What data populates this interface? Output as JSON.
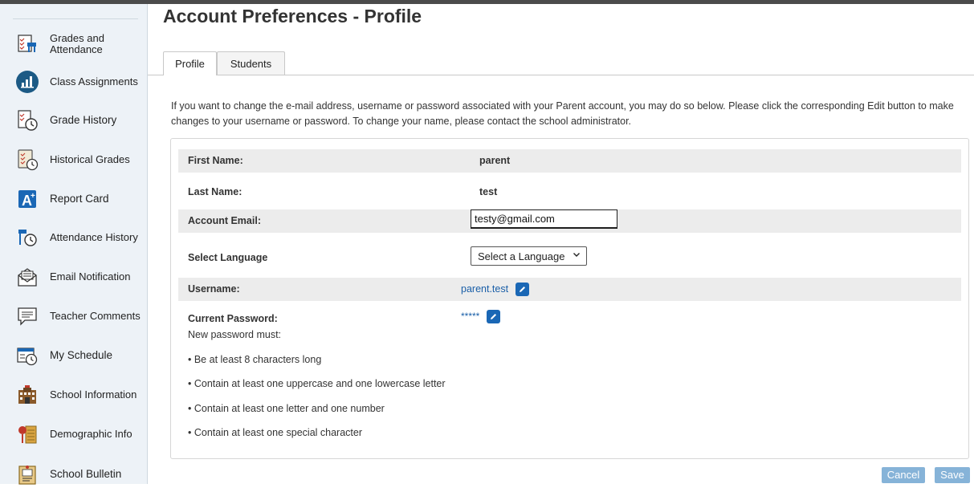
{
  "sidebar": {
    "items": [
      {
        "label": "Grades and Attendance",
        "icon": "grades-attendance-icon"
      },
      {
        "label": "Class Assignments",
        "icon": "class-assignments-icon"
      },
      {
        "label": "Grade History",
        "icon": "grade-history-icon"
      },
      {
        "label": "Historical Grades",
        "icon": "historical-grades-icon"
      },
      {
        "label": "Report Card",
        "icon": "report-card-icon"
      },
      {
        "label": "Attendance History",
        "icon": "attendance-history-icon"
      },
      {
        "label": "Email Notification",
        "icon": "email-notification-icon"
      },
      {
        "label": "Teacher Comments",
        "icon": "teacher-comments-icon"
      },
      {
        "label": "My Schedule",
        "icon": "my-schedule-icon"
      },
      {
        "label": "School Information",
        "icon": "school-information-icon"
      },
      {
        "label": "Demographic Info",
        "icon": "demographic-info-icon"
      },
      {
        "label": "School Bulletin",
        "icon": "school-bulletin-icon"
      }
    ]
  },
  "page": {
    "title": "Account Preferences - Profile",
    "tabs": [
      {
        "label": "Profile",
        "active": true
      },
      {
        "label": "Students",
        "active": false
      }
    ],
    "intro": "If you want to change the e-mail address, username or password associated with your Parent account, you may do so below. Please click the corresponding Edit button to make changes to your username or password. To change your name, please contact the school administrator."
  },
  "profile": {
    "first_name_label": "First Name:",
    "first_name": "parent",
    "last_name_label": "Last Name:",
    "last_name": "test",
    "email_label": "Account Email:",
    "email_value": "testy@gmail.com",
    "language_label": "Select Language",
    "language_selected": "Select a Language",
    "username_label": "Username:",
    "username": "parent.test",
    "password_label": "Current Password:",
    "password_masked": "*****",
    "pw_rules_heading": "New password must:",
    "pw_rules": [
      "• Be at least 8 characters long",
      "• Contain at least one uppercase and one lowercase letter",
      "• Contain at least one letter and one number",
      "• Contain at least one special character"
    ]
  },
  "actions": {
    "cancel_label": "Cancel",
    "save_label": "Save"
  },
  "colors": {
    "accent": "#1a67b5",
    "sidebar_bg": "#edf2f7",
    "row_shade": "#ececec",
    "disabled_button": "#86b3d8"
  }
}
